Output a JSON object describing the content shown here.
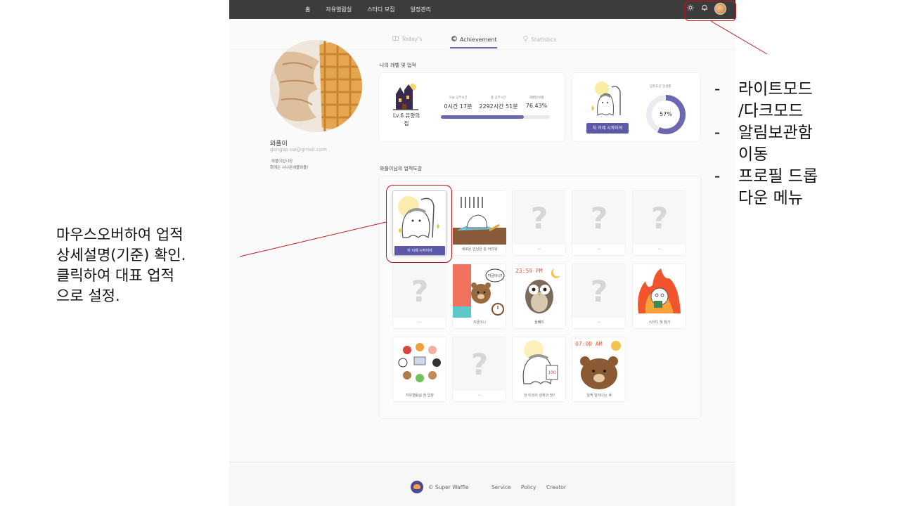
{
  "nav": {
    "items": [
      "홈",
      "자유열람실",
      "스터디 모집",
      "일정관리"
    ],
    "icons": [
      "sun-icon",
      "bell-icon"
    ]
  },
  "tabs": [
    {
      "label": "Today's",
      "active": false
    },
    {
      "label": "Achievement",
      "active": true
    },
    {
      "label": "Statistics",
      "active": false
    }
  ],
  "profile": {
    "name": "와플이",
    "email": "gongsp.sw@gmail.com",
    "bio_line1": "와플이입니당",
    "bio_line2": "화에는 시나몬애플와플!"
  },
  "level_section": {
    "title": "나의 레벨 및 업적",
    "level_name": "Lv.6 유령의\n집",
    "stats": [
      {
        "label": "오늘 공부시간",
        "value": "0시간 17분"
      },
      {
        "label": "총 공부시간",
        "value": "2292시간 51분"
      },
      {
        "label": "레벨달성률",
        "value": "76.43%"
      }
    ],
    "progress_fraction": 0.7643,
    "rep_achievement_label": "자 이제 시작이야",
    "achievement_rate_label": "업적도감 달성률",
    "achievement_rate": "57%",
    "achievement_rate_fraction": 0.57
  },
  "collection": {
    "title": "와플이님의 업적도감",
    "tiles": [
      {
        "caption": "자 이제 시작이야",
        "state": "highlight",
        "art": "ghost-start"
      },
      {
        "caption": "새로운 만남은 늘 어려워",
        "state": "unlocked",
        "art": "ghost-wall"
      },
      {
        "caption": "...",
        "state": "locked",
        "art": "locked"
      },
      {
        "caption": "...",
        "state": "locked",
        "art": "locked"
      },
      {
        "caption": "...",
        "state": "locked",
        "art": "locked"
      },
      {
        "caption": "...",
        "state": "locked",
        "art": "locked"
      },
      {
        "caption": "지금이니",
        "state": "unlocked",
        "art": "bear-clock"
      },
      {
        "caption": "올빼미",
        "state": "unlocked",
        "art": "owl"
      },
      {
        "caption": "...",
        "state": "locked",
        "art": "locked"
      },
      {
        "caption": "스터디 첫 참가",
        "state": "unlocked",
        "art": "fire"
      },
      {
        "caption": "자유열람실 첫 입장",
        "state": "unlocked",
        "art": "animals"
      },
      {
        "caption": "...",
        "state": "locked",
        "art": "locked"
      },
      {
        "caption": "앗 이것이 성취의 맛?",
        "state": "unlocked",
        "art": "ghost-100"
      },
      {
        "caption": "일찍 일어나는 새",
        "state": "unlocked",
        "art": "bear-sun"
      }
    ],
    "clock_text_1": "23:59 PM",
    "clock_text_2": "07:00 AM",
    "speech_text": "지금이니?"
  },
  "footer": {
    "copyright": "© Super Waffle",
    "links": [
      "Service",
      "Policy",
      "Creator"
    ]
  },
  "annotations": {
    "left": [
      "마우스오버하여 업적",
      "상세설명(기준) 확인.",
      "클릭하여 대표 업적",
      "으로 설정."
    ],
    "right": [
      {
        "dash": "-",
        "lines": [
          "라이트모드",
          "/다크모드"
        ]
      },
      {
        "dash": "-",
        "lines": [
          "알림보관함",
          "이동"
        ]
      },
      {
        "dash": "-",
        "lines": [
          "프로필 드롭",
          "다운 메뉴"
        ]
      }
    ]
  },
  "colors": {
    "accent": "#5c5aa8",
    "topbar": "#3c3c3c",
    "annotation_red": "#c0151c"
  }
}
